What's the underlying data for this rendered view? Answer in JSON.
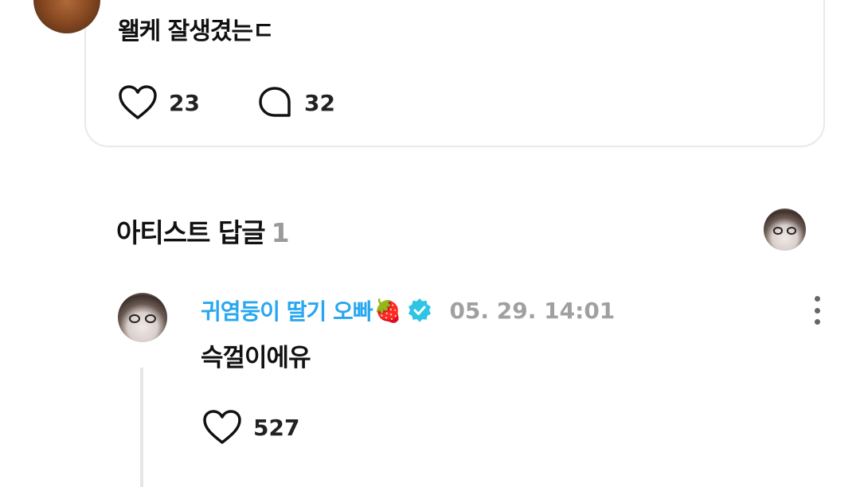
{
  "post": {
    "text": "왤케 잘생겼는ㄷ",
    "like_count": "23",
    "comment_count": "32"
  },
  "artist_replies": {
    "title": "아티스트 답글",
    "count": "1"
  },
  "reply": {
    "author": "귀염둥이 딸기 오빠",
    "author_emoji": "🍓",
    "timestamp": "05. 29. 14:01",
    "text": "슥껄이에유",
    "like_count": "527"
  },
  "colors": {
    "author_name": "#28a7f0",
    "verified_badge": "#2ec4e6",
    "muted_text": "#a0a0a0",
    "card_border": "#e9e9ec"
  },
  "icons": [
    "heart-icon",
    "comment-bubble-icon",
    "verified-badge-icon",
    "more-vertical-icon"
  ]
}
